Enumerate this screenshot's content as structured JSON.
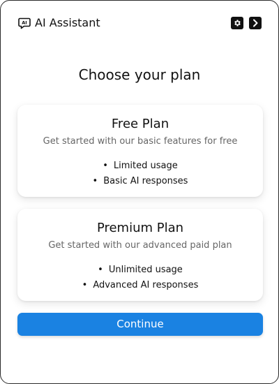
{
  "header": {
    "title": "AI Assistant",
    "brand_icon": "ai-chat-icon",
    "actions": [
      {
        "icon": "gear-icon"
      },
      {
        "icon": "chevron-right-icon"
      }
    ]
  },
  "main": {
    "heading": "Choose your plan",
    "plans": [
      {
        "name": "Free Plan",
        "description": "Get started with our basic features for free",
        "features": [
          "Limited usage",
          "Basic AI responses"
        ]
      },
      {
        "name": "Premium Plan",
        "description": "Get started with our advanced paid plan",
        "features": [
          "Unlimited usage",
          "Advanced AI responses"
        ]
      }
    ],
    "continue_label": "Continue"
  },
  "colors": {
    "accent": "#1a82e2",
    "text": "#111111",
    "muted": "#666666"
  }
}
